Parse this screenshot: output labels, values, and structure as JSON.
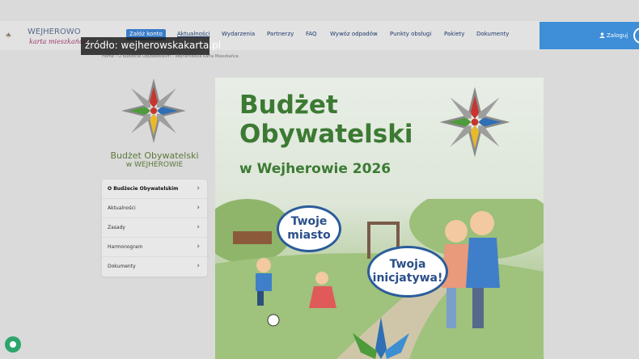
{
  "header": {
    "logo_line1": "WEJHEROWO",
    "logo_line2": "karta mieszkańca",
    "source_overlay": "źródło: wejherowskakarta.pl",
    "nav": [
      "Załóż konto",
      "Aktualności",
      "Wydarzenia",
      "Partnerzy",
      "FAQ",
      "Wywóz odpadów",
      "Punkty obsługi",
      "Pakiety",
      "Dokumenty"
    ],
    "login_label": "Zaloguj"
  },
  "breadcrumb": "Home  ›  O Budżecie Obywatelskim  ›  Wejherowska Karta Mieszkańca",
  "sidebar": {
    "title_line1": "Budżet Obywatelski",
    "title_line2": "w WEJHEROWIE",
    "items": [
      {
        "label": "O Budżecie Obywatelskim"
      },
      {
        "label": "Aktualności"
      },
      {
        "label": "Zasady"
      },
      {
        "label": "Harmonogram"
      },
      {
        "label": "Dokumenty"
      }
    ]
  },
  "poster": {
    "title_line1": "Budżet",
    "title_line2": "Obywatelski",
    "subtitle": "w Wejherowie 2026",
    "bubble1": [
      "Twoje",
      "miasto"
    ],
    "bubble2": [
      "Twoja",
      "inicjatywa!"
    ]
  },
  "colors": {
    "accent": "#3e8ed8",
    "green": "#3c7a33",
    "bubble_border": "#2a5c9a"
  }
}
